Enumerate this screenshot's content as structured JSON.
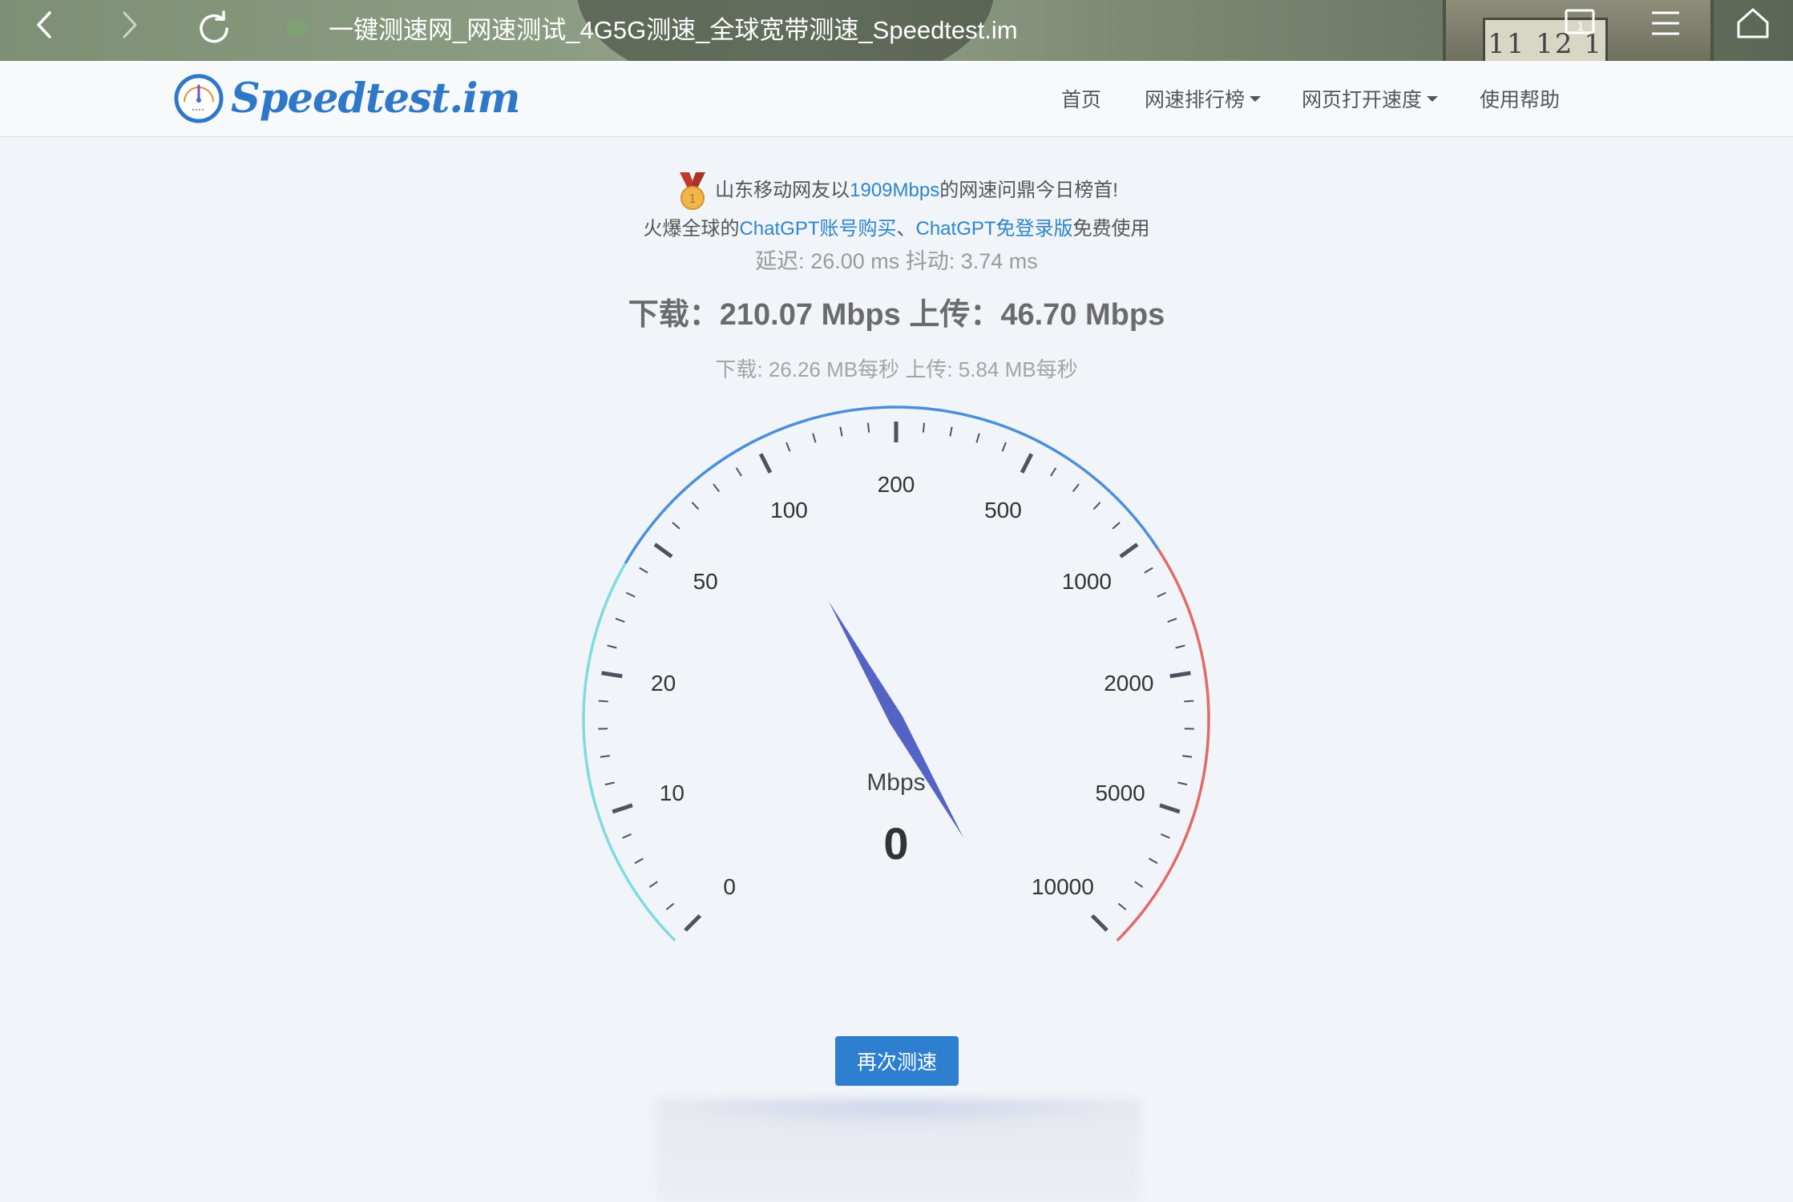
{
  "browser": {
    "title": "一键测速网_网速测试_4G5G测速_全球宽带测速_Speedtest.im",
    "background_clock_text": "11 12 1"
  },
  "site": {
    "logo_text": "Speedtest.im",
    "nav": [
      {
        "label": "首页",
        "dropdown": false
      },
      {
        "label": "网速排行榜",
        "dropdown": true
      },
      {
        "label": "网页打开速度",
        "dropdown": true
      },
      {
        "label": "使用帮助",
        "dropdown": false
      }
    ]
  },
  "announce": {
    "prefix": "山东移动网友以",
    "speed_link": "1909Mbps",
    "suffix": "的网速问鼎今日榜首!"
  },
  "promo": {
    "prefix": "火爆全球的",
    "link1": "ChatGPT账号购买",
    "sep": "、",
    "link2": "ChatGPT免登录版",
    "suffix": "免费使用"
  },
  "latency_text": "延迟: 26.00 ms 抖动: 3.74 ms",
  "result_text": "下载：210.07 Mbps 上传：46.70 Mbps",
  "bytes_text": "下载: 26.26 MB每秒 上传: 5.84 MB每秒",
  "gauge": {
    "unit": "Mbps",
    "value": "0",
    "needle_mbps": 95,
    "labels": [
      "0",
      "10",
      "20",
      "50",
      "100",
      "200",
      "500",
      "1000",
      "2000",
      "5000",
      "10000"
    ],
    "colors": {
      "low": "#7fdbe0",
      "mid": "#4a90d9",
      "high": "#e06b6b",
      "needle": "#5564c4",
      "tick": "#4d5360"
    }
  },
  "retest_button": "再次测速"
}
